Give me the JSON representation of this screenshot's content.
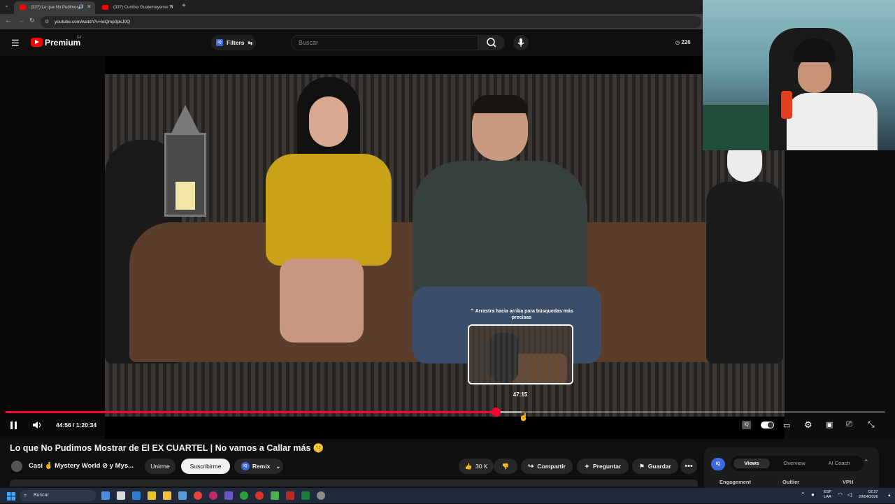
{
  "browser": {
    "tabs": [
      {
        "label": "(337) Lo que No Pudimos M",
        "active": true
      },
      {
        "label": "(337) Cumbia Guatemayense Ti",
        "active": false
      }
    ],
    "new_tab": "+",
    "url": "youtube.com/watch?v=ieQmp0pkJ0Q"
  },
  "yt_header": {
    "logo_text": "Premium",
    "logo_sup": "GT",
    "filters_label": "Filters",
    "filters_badge": "IQ",
    "search_placeholder": "Buscar",
    "view_count": "226"
  },
  "player": {
    "drag_hint": "Arrastra hacia arriba para búsquedas más precisas",
    "preview_time": "47:15",
    "current_time": "44:56",
    "duration": "1:20:34",
    "timecode": "44:56 / 1:20:34",
    "progress_fraction": 0.5574,
    "hover_fraction": 0.5865,
    "state": "playing",
    "accent": "#ff0033"
  },
  "video_meta": {
    "title": "Lo que No Pudimos Mostrar de El EX CUARTEL | No vamos a Callar más 🤫",
    "channel": "Casi 🤞 Mystery World ⊘ y Mys...",
    "join_label": "Unirme",
    "subscribe_label": "Suscribirme",
    "remix_label": "Remix",
    "remix_badge": "IQ",
    "likes": "30 K",
    "share_label": "Compartir",
    "ask_label": "Preguntar",
    "save_label": "Guardar",
    "more_label": "•••"
  },
  "side_panel": {
    "badge": "IQ",
    "tabs": [
      "Views",
      "Overview",
      "AI Coach"
    ],
    "active_tab": "Views",
    "labels": [
      "Engagement",
      "Outlier",
      "VPH"
    ]
  },
  "taskbar": {
    "search_placeholder": "Buscar",
    "lang_top": "ESP",
    "lang_bottom": "LAA",
    "time": "02:37",
    "date": "20/04/2026"
  }
}
